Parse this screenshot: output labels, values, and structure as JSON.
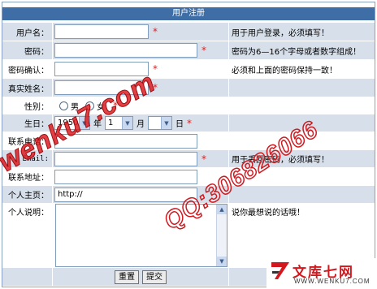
{
  "form": {
    "title": "用户注册"
  },
  "fields": {
    "username": {
      "label": "用户名：",
      "value": "",
      "note": "用于用户登录，必须填写！"
    },
    "password": {
      "label": "密码：",
      "value": "",
      "note": "密码为6—16个字母或者数字组成！"
    },
    "confirm": {
      "label": "密码确认：",
      "value": "",
      "note": "必须和上面的密码保持一致！"
    },
    "realname": {
      "label": "真实姓名：",
      "value": ""
    },
    "gender": {
      "label": "性别：",
      "male": "男",
      "female": "女"
    },
    "birthday": {
      "label": "生日：",
      "year": "1950",
      "year_unit": "年",
      "month": "1",
      "month_unit": "月",
      "day": "",
      "day_unit": "日"
    },
    "phone": {
      "label": "联系电话：",
      "value": ""
    },
    "email": {
      "label": "Email:",
      "value": "",
      "note": "用于丢回密码，必须填写！"
    },
    "address": {
      "label": "联系地址：",
      "value": ""
    },
    "homepage": {
      "label": "个人主页：",
      "value": "http://"
    },
    "intro": {
      "label": "个人说明：",
      "value": "",
      "note": "说你最想说的话哦！"
    }
  },
  "required_mark": "*",
  "buttons": {
    "reset": "重置",
    "submit": "提交"
  },
  "watermarks": {
    "site": "wenku7.com",
    "qq": "QQ:306826066"
  },
  "logo": {
    "brand": "文库七网",
    "domain": "WWW.WENKU7.COM"
  },
  "colors": {
    "title_bar": "#3f6ea7",
    "row_shade": "#d7e0ea",
    "required": "#e02020",
    "watermark": "#d0181e"
  }
}
